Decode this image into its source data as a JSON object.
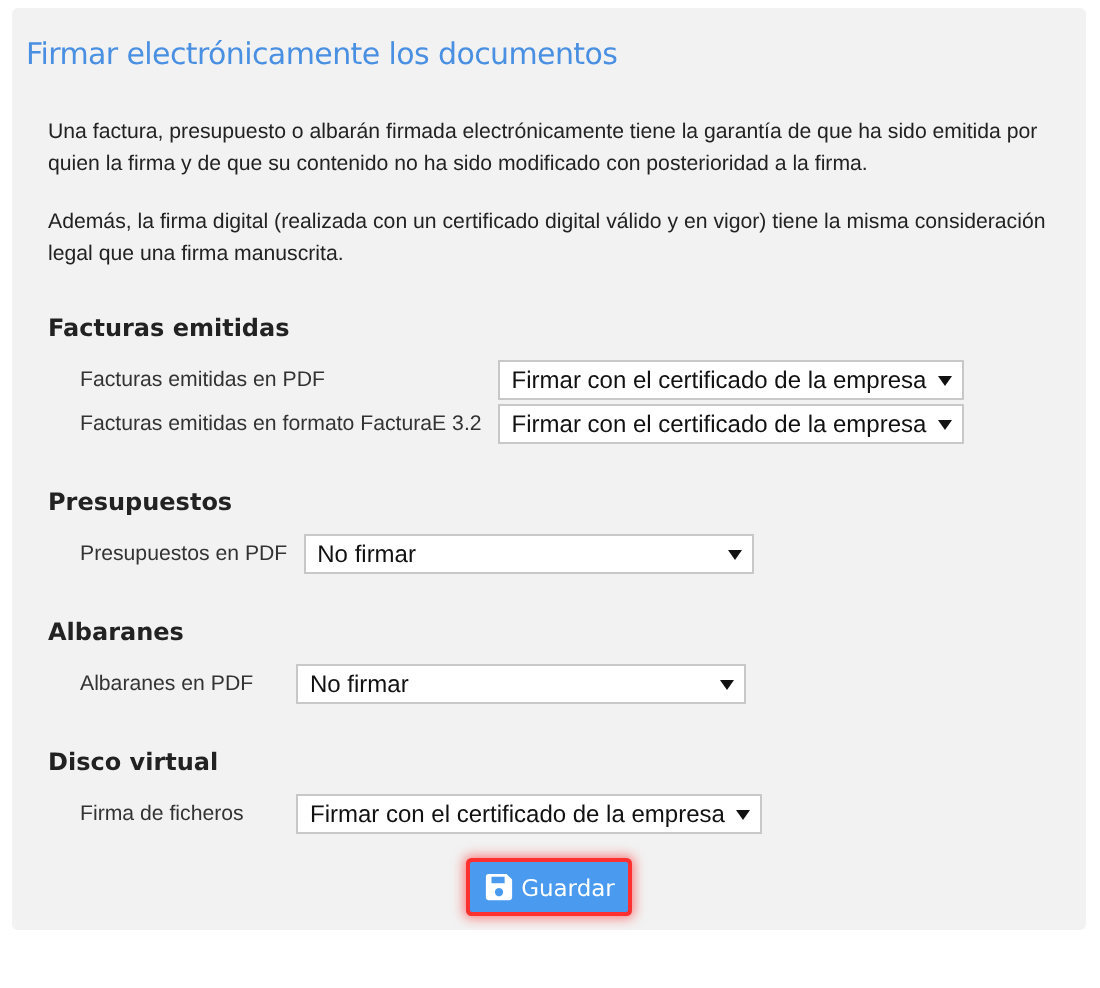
{
  "title": "Firmar electrónicamente los documentos",
  "paragraphs": [
    "Una factura, presupuesto o albarán firmada electrónicamente tiene la garantía de que ha sido emitida por quien la firma y de que su contenido no ha sido modificado con posterioridad a la firma.",
    "Además, la firma digital (realizada con un certificado digital válido y en vigor) tiene la misma consideración legal que una firma manuscrita."
  ],
  "sections": [
    {
      "heading": "Facturas emitidas",
      "rows": [
        {
          "label": "Facturas emitidas en PDF",
          "value": "Firmar con el certificado de la empresa"
        },
        {
          "label": "Facturas emitidas en formato FacturaE 3.2",
          "value": "Firmar con el certificado de la empresa"
        }
      ]
    },
    {
      "heading": "Presupuestos",
      "rows": [
        {
          "label": "Presupuestos en PDF",
          "value": "No firmar"
        }
      ]
    },
    {
      "heading": "Albaranes",
      "rows": [
        {
          "label": "Albaranes en PDF",
          "value": "No firmar"
        }
      ]
    },
    {
      "heading": "Disco virtual",
      "rows": [
        {
          "label": "Firma de ficheros",
          "value": "Firmar con el certificado de la empresa"
        }
      ]
    }
  ],
  "save_button": {
    "label": "Guardar",
    "highlighted": true
  }
}
